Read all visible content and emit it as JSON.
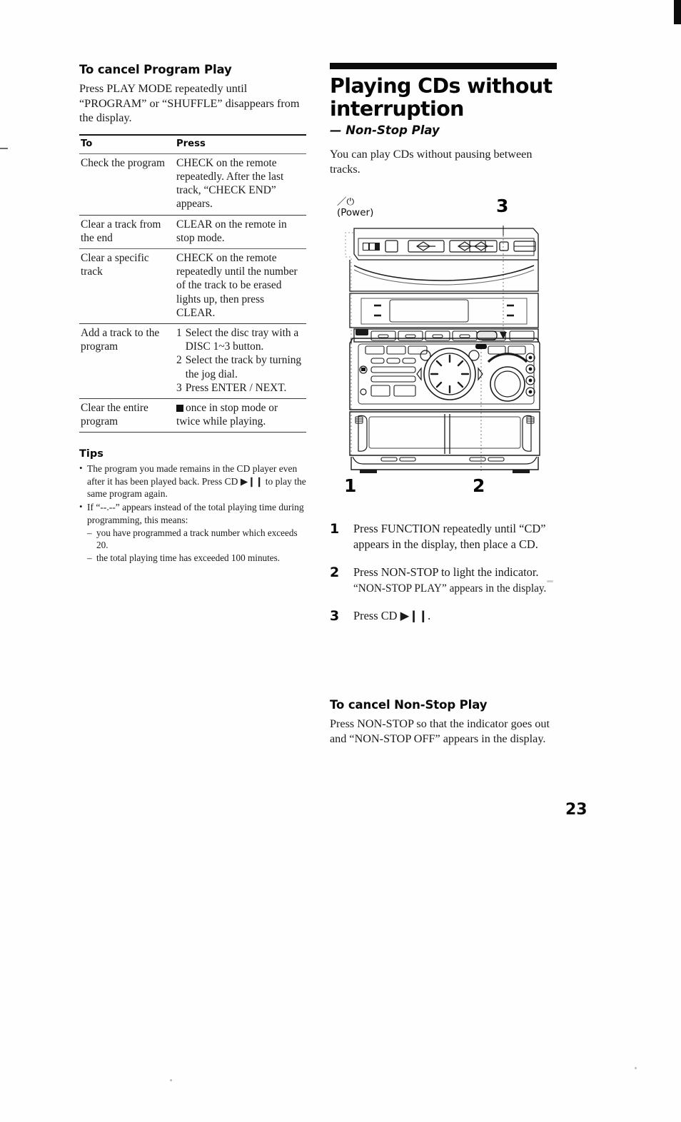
{
  "page": {
    "number": "23"
  },
  "left": {
    "cancel_program": {
      "heading": "To cancel Program Play",
      "body": "Press PLAY MODE repeatedly until “PROGRAM” or “SHUFFLE” disappears from the display."
    },
    "table": {
      "headers": [
        "To",
        "Press"
      ],
      "rows": [
        {
          "to": "Check the program",
          "press": "CHECK on the remote repeatedly. After the last track, “CHECK END” appears."
        },
        {
          "to": "Clear a track from the end",
          "press": "CLEAR on the remote in stop mode."
        },
        {
          "to": "Clear a specific track",
          "press": "CHECK on the remote repeatedly until the number of the track to be erased lights up, then press CLEAR."
        },
        {
          "to": "Add a track to the program",
          "press_steps": [
            {
              "n": "1",
              "t": "Select the disc tray with a DISC 1~3 button."
            },
            {
              "n": "2",
              "t": "Select the track by turning the jog dial."
            },
            {
              "n": "3",
              "t": "Press ENTER / NEXT."
            }
          ]
        },
        {
          "to": "Clear the entire program",
          "press": "once in stop mode or twice while playing.",
          "press_icon": "stop-square-icon"
        }
      ]
    },
    "tips": {
      "heading": "Tips",
      "items": [
        {
          "text_before": "The program you made remains in the CD player even after it has been played back. Press CD ",
          "icon": "play-pause-icon",
          "text_after": " to play the same program again."
        },
        {
          "text_before": "If “--.--” appears instead of the total playing time during programming, this means:",
          "sub": [
            "you have programmed a track number which exceeds 20.",
            "the total playing time has exceeded 100 minutes."
          ]
        }
      ]
    }
  },
  "right": {
    "title": "Playing CDs without interruption",
    "subtitle": "— Non-Stop Play",
    "intro": "You can play CDs without pausing between tracks.",
    "diagram": {
      "power_label_line1": "／⏻",
      "power_label_line2": "(Power)",
      "callouts": [
        {
          "label": "3"
        },
        {
          "label": "1"
        },
        {
          "label": "2"
        }
      ]
    },
    "steps": [
      {
        "num": "1",
        "text": "Press FUNCTION repeatedly until “CD” appears in the display, then place a CD.",
        "sub": ""
      },
      {
        "num": "2",
        "text": "Press NON-STOP to light the indicator.",
        "sub": "“NON-STOP PLAY” appears in the display."
      },
      {
        "num": "3",
        "text_before": "Press CD ",
        "icon": "play-pause-icon",
        "text_after": "."
      }
    ],
    "cancel_nonstop": {
      "heading": "To cancel Non-Stop Play",
      "body": "Press NON-STOP so that the indicator goes out and “NON-STOP OFF” appears in the display."
    }
  }
}
